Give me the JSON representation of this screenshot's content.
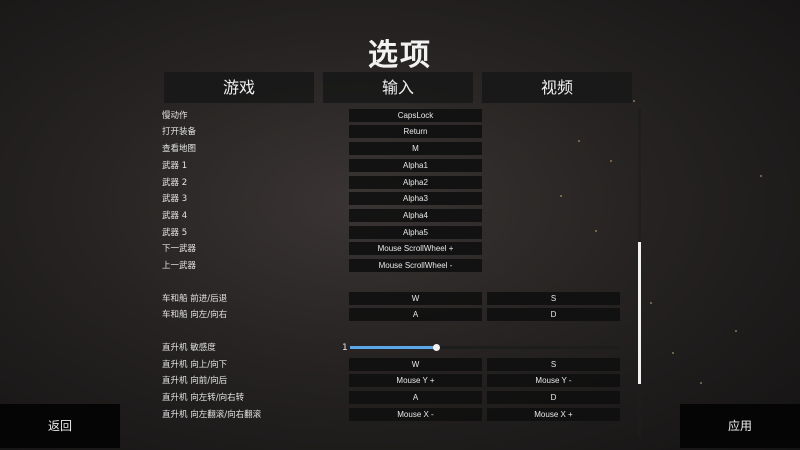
{
  "title": "选项",
  "tabs": [
    {
      "label": "游戏"
    },
    {
      "label": "输入"
    },
    {
      "label": "视频"
    }
  ],
  "bindings": [
    {
      "label": "慢动作",
      "keys": [
        "CapsLock"
      ]
    },
    {
      "label": "打开装备",
      "keys": [
        "Return"
      ]
    },
    {
      "label": "查看地图",
      "keys": [
        "M"
      ]
    },
    {
      "label": "武器 1",
      "keys": [
        "Alpha1"
      ]
    },
    {
      "label": "武器 2",
      "keys": [
        "Alpha2"
      ]
    },
    {
      "label": "武器 3",
      "keys": [
        "Alpha3"
      ]
    },
    {
      "label": "武器 4",
      "keys": [
        "Alpha4"
      ]
    },
    {
      "label": "武器 5",
      "keys": [
        "Alpha5"
      ]
    },
    {
      "label": "下一武器",
      "keys": [
        "Mouse ScrollWheel +"
      ]
    },
    {
      "label": "上一武器",
      "keys": [
        "Mouse ScrollWheel -"
      ]
    },
    {
      "label": "车和船 前进/后退",
      "keys": [
        "W",
        "S"
      ]
    },
    {
      "label": "车和船 向左/向右",
      "keys": [
        "A",
        "D"
      ]
    },
    {
      "label": "直升机 向上/向下",
      "keys": [
        "W",
        "S"
      ]
    },
    {
      "label": "直升机 向前/向后",
      "keys": [
        "Mouse Y +",
        "Mouse Y -"
      ]
    },
    {
      "label": "直升机 向左转/向右转",
      "keys": [
        "A",
        "D"
      ]
    },
    {
      "label": "直升机 向左翻滚/向右翻滚",
      "keys": [
        "Mouse X -",
        "Mouse X +"
      ]
    }
  ],
  "sensitivity": {
    "label": "直升机 敏感度",
    "value": "1",
    "fill_fraction": 0.32
  },
  "scroll_position": {
    "thumb_fraction": 0.43,
    "position_fraction": 0.41
  },
  "buttons": {
    "back": "返回",
    "apply": "应用"
  },
  "colors": {
    "accent": "#5aa7ea",
    "panel": "#181818",
    "text": "#e8e8e8"
  }
}
